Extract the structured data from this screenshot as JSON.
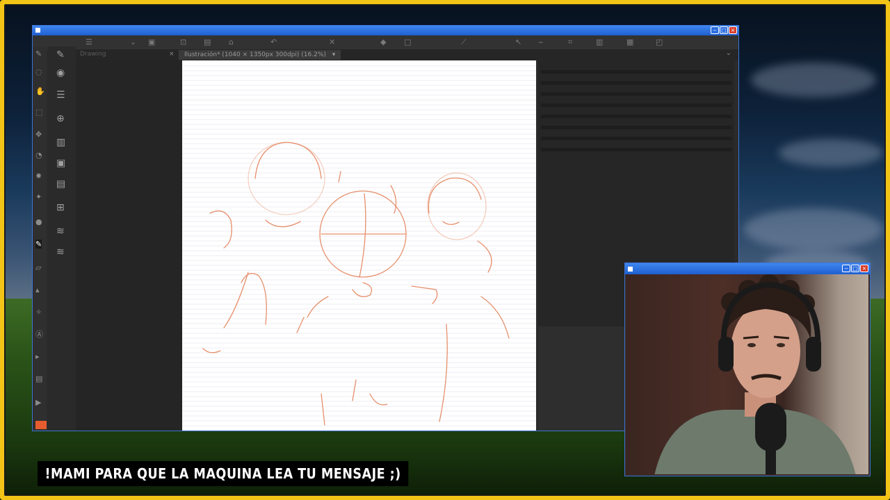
{
  "document": {
    "inactive_tab": "Drawing",
    "tab_title": "Ilustración* (1040 × 1350px 300dpi) (16.2%)",
    "tab_close": "×",
    "tab_menu": "▾",
    "collapse": "⌄"
  },
  "window": {
    "minimize": "‒",
    "maximize": "□",
    "close": "×"
  },
  "subtitle": {
    "text": "!MAMI PARA QUE LA MAQUINA LEA TU MENSAJE ;)"
  },
  "colors": {
    "frame": "#f2c417",
    "titlebar": "#1f5fd0",
    "sketch": "#e06a3a",
    "active_color": "#e55c2e"
  },
  "icons": {
    "left_toolbar": [
      "pen",
      "lasso",
      "hand",
      "selection",
      "move",
      "eyedropper",
      "brush",
      "airbrush",
      "pencil",
      "eraser",
      "fill",
      "gradient",
      "text",
      "ruler",
      "color-swatch"
    ],
    "sub_tools": [
      "pen-subtool",
      "eye",
      "sliders",
      "zoom",
      "layers-panel",
      "image-layer",
      "folder",
      "grid",
      "layer-stack",
      "layer-stack-2"
    ]
  }
}
